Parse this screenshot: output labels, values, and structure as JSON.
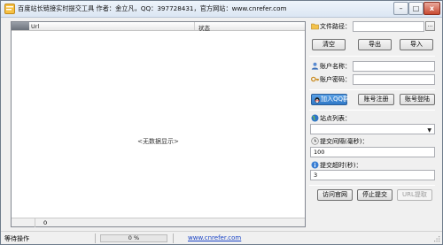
{
  "window": {
    "title": "百度站长链接实时提交工具 作者：金立凡，QQ：397728431，官方网站：www.cnrefer.com",
    "buttons": {
      "minimize": "–",
      "maximize": "□",
      "close": "x"
    }
  },
  "list": {
    "columns": [
      "Url",
      "状态"
    ],
    "empty_text": "<无数据显示>",
    "footer_count": "0"
  },
  "panel": {
    "file_path_label": "文件路径：",
    "file_path_value": "",
    "browse_label": "...",
    "clear_button": "清空",
    "export_button": "导出",
    "import_button": "导入",
    "account_name_label": "账户名称：",
    "account_name_value": "",
    "account_password_label": "账户密码：",
    "account_password_value": "",
    "join_qq_button": "加入QQ群",
    "register_button": "账号注册",
    "login_button": "账号登陆",
    "site_list_label": "站点列表：",
    "site_list_value": "",
    "interval_label": "提交间隔(毫秒)：",
    "interval_value": "100",
    "timeout_label": "提交超时(秒)：",
    "timeout_value": "3",
    "visit_site_button": "访问官网",
    "stop_submit_button": "停止提交",
    "url_extract_button": "URL提取"
  },
  "status": {
    "text": "等待操作",
    "progress_percent": 0,
    "progress_text": "0 %",
    "link": "www.cnrefer.com"
  },
  "colors": {
    "accent": "#2f78c7",
    "link": "#1a44c6",
    "progress": "#06b025"
  }
}
